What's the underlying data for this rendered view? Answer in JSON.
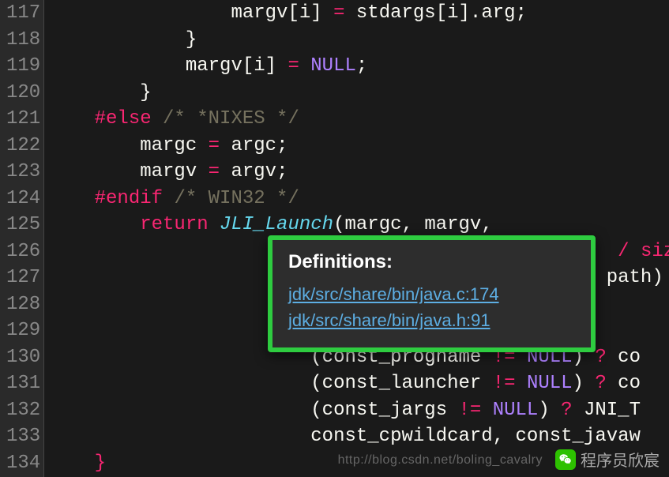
{
  "gutter": {
    "start": 117,
    "end": 134
  },
  "code": {
    "l117": {
      "pre": "                ",
      "id1": "margv",
      "br1": "[",
      "id2": "i",
      "br2": "] ",
      "op": "=",
      "sp": " ",
      "id3": "stdargs",
      "br3": "[",
      "id4": "i",
      "br4": "].",
      "id5": "arg",
      "sc": ";"
    },
    "l118": {
      "pre": "            ",
      "br": "}"
    },
    "l119": {
      "pre": "            ",
      "id1": "margv",
      "br1": "[",
      "id2": "i",
      "br2": "] ",
      "op": "=",
      "sp": " ",
      "cn": "NULL",
      "sc": ";"
    },
    "l120": {
      "pre": "        ",
      "br": "}"
    },
    "l121": {
      "pre": "    ",
      "pp": "#else",
      "sp": " ",
      "cm": "/* *NIXES */"
    },
    "l122": {
      "pre": "        ",
      "id1": "margc ",
      "op": "=",
      "sp": " ",
      "id2": "argc",
      "sc": ";"
    },
    "l123": {
      "pre": "        ",
      "id1": "margv ",
      "op": "=",
      "sp": " ",
      "id2": "argv",
      "sc": ";"
    },
    "l124": {
      "pre": "    ",
      "pp": "#endif",
      "sp": " ",
      "cm": "/* WIN32 */"
    },
    "l125": {
      "pre": "        ",
      "kw": "return",
      "sp": " ",
      "fn": "JLI_Launch",
      "br1": "(",
      "id1": "margc",
      "cm1": ", ",
      "id2": "margv",
      "cm2": ","
    },
    "l126": {
      "pre": "                                                  ",
      "op": "/",
      "sp": " ",
      "kw": "sizeof"
    },
    "l127": {
      "pre": "                                                 ",
      "id": "path",
      "br": ") ",
      "op": "/"
    },
    "l128": {
      "pre": ""
    },
    "l129": {
      "pre": ""
    },
    "l130": {
      "pre": "                       ",
      "br1": "(",
      "id1": "const_progname ",
      "op": "!=",
      "sp": " ",
      "cn": "NULL",
      "br2": ") ",
      "qm": "?",
      "sp2": " ",
      "id2": "co"
    },
    "l131": {
      "pre": "                       ",
      "br1": "(",
      "id1": "const_launcher ",
      "op": "!=",
      "sp": " ",
      "cn": "NULL",
      "br2": ") ",
      "qm": "?",
      "sp2": " ",
      "id2": "co"
    },
    "l132": {
      "pre": "                       ",
      "br1": "(",
      "id1": "const_jargs ",
      "op": "!=",
      "sp": " ",
      "cn": "NULL",
      "br2": ") ",
      "qm": "?",
      "sp2": " ",
      "id2": "JNI_T"
    },
    "l133": {
      "pre": "                       ",
      "id1": "const_cpwildcard",
      "cm1": ", ",
      "id2": "const_javaw"
    },
    "l134": {
      "pre": "    ",
      "br": "}"
    }
  },
  "tooltip": {
    "title": "Definitions:",
    "links": [
      "jdk/src/share/bin/java.c:174",
      "jdk/src/share/bin/java.h:91"
    ]
  },
  "watermark": {
    "text": "程序员欣宸",
    "url": "http://blog.csdn.net/boling_cavalry"
  }
}
